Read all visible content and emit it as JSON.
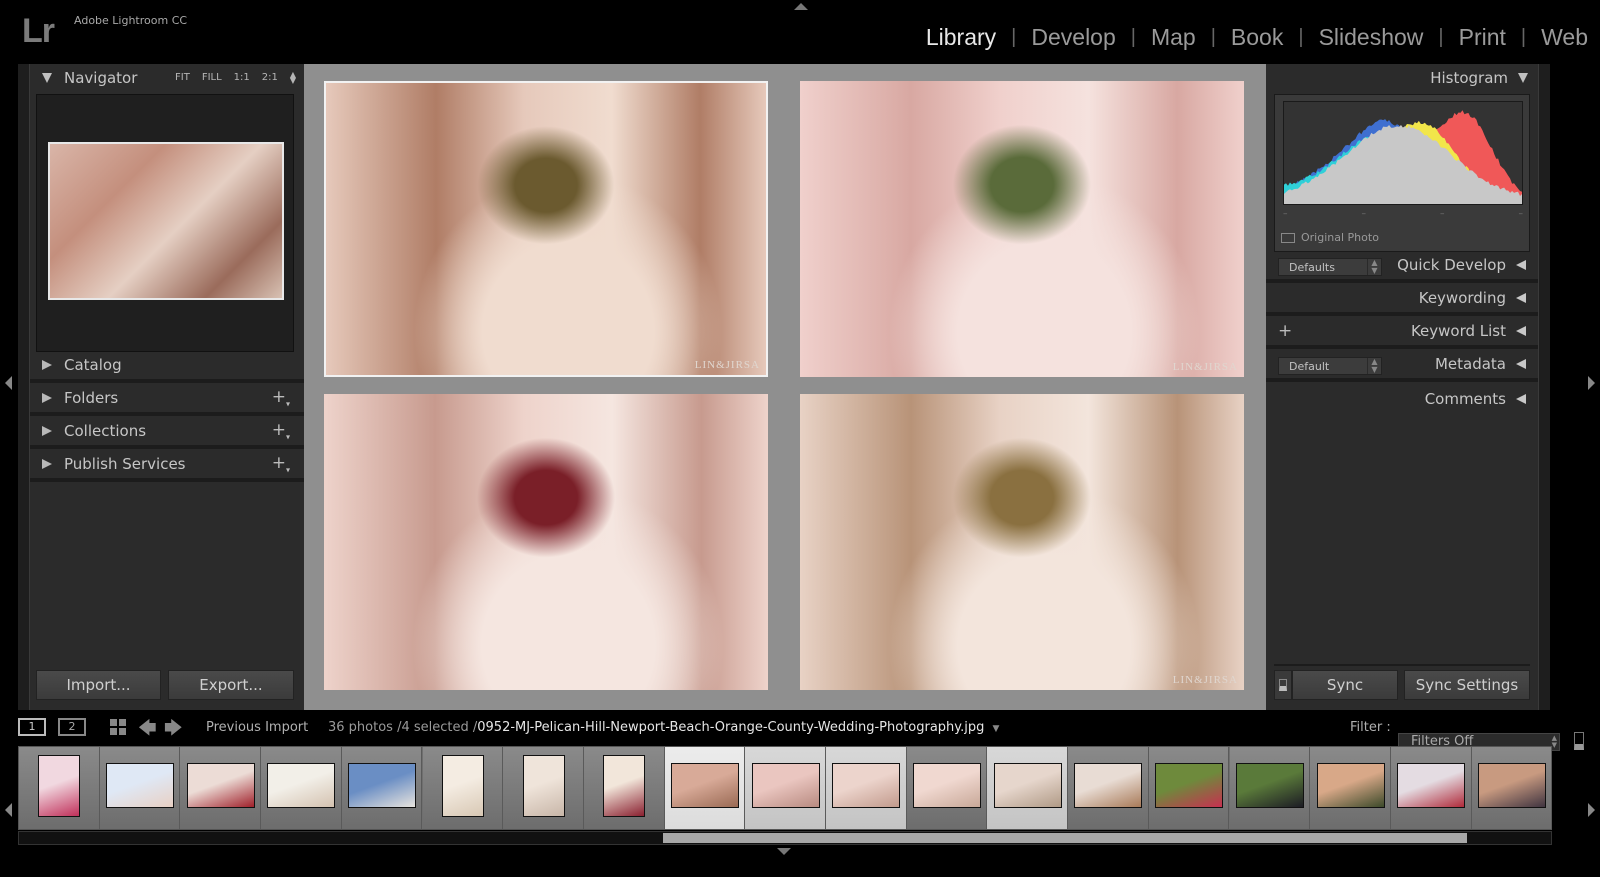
{
  "app": {
    "logo": "Lr",
    "title": "Adobe Lightroom CC"
  },
  "modules": [
    {
      "label": "Library",
      "active": true
    },
    {
      "label": "Develop",
      "active": false
    },
    {
      "label": "Map",
      "active": false
    },
    {
      "label": "Book",
      "active": false
    },
    {
      "label": "Slideshow",
      "active": false
    },
    {
      "label": "Print",
      "active": false
    },
    {
      "label": "Web",
      "active": false
    }
  ],
  "left_panel": {
    "navigator": {
      "title": "Navigator",
      "zoom_options": [
        "FIT",
        "FILL",
        "1:1",
        "2:1"
      ]
    },
    "sections": [
      {
        "label": "Catalog",
        "has_plus": false
      },
      {
        "label": "Folders",
        "has_plus": true
      },
      {
        "label": "Collections",
        "has_plus": true
      },
      {
        "label": "Publish Services",
        "has_plus": true
      }
    ],
    "import_label": "Import...",
    "export_label": "Export..."
  },
  "right_panel": {
    "histogram": {
      "title": "Histogram",
      "original_photo_label": "Original Photo"
    },
    "quick_develop": {
      "label": "Quick Develop",
      "preset": "Defaults"
    },
    "keywording": {
      "label": "Keywording"
    },
    "keyword_list": {
      "label": "Keyword List",
      "plus": "+"
    },
    "metadata": {
      "label": "Metadata",
      "preset": "Default"
    },
    "comments": {
      "label": "Comments"
    },
    "sync_label": "Sync",
    "sync_settings_label": "Sync Settings"
  },
  "center": {
    "view": "survey",
    "photos": [
      {
        "id": "photo-1",
        "selected": true,
        "watermark": "LIN&JIRSA",
        "palette": [
          "#e6c9bb",
          "#b07d66",
          "#f0dccf",
          "#6b5a2f"
        ]
      },
      {
        "id": "photo-2",
        "selected": false,
        "watermark": "LIN&JIRSA",
        "palette": [
          "#f0d0cc",
          "#d8a8a2",
          "#f5e2de",
          "#5a6b3a"
        ]
      },
      {
        "id": "photo-3",
        "selected": false,
        "watermark": "",
        "palette": [
          "#eed3cb",
          "#c79a8e",
          "#f5e6e0",
          "#7a1f28"
        ]
      },
      {
        "id": "photo-4",
        "selected": false,
        "watermark": "LIN&JIRSA",
        "palette": [
          "#e8d2c5",
          "#b89378",
          "#f3e5dc",
          "#8a7040"
        ]
      }
    ]
  },
  "filmstrip_bar": {
    "monitor_1": "1",
    "monitor_2": "2",
    "source": "Previous Import",
    "count": "36 photos /4 selected /",
    "filename": "0952-MJ-Pelican-Hill-Newport-Beach-Orange-County-Wedding-Photography.jpg",
    "filter_label": "Filter :",
    "filter_value": "Filters Off"
  },
  "filmstrip": {
    "thumbnails": [
      {
        "orientation": "portrait",
        "state": "normal",
        "colors": [
          "#f1d8e0",
          "#c0305a"
        ]
      },
      {
        "orientation": "landscape",
        "state": "normal",
        "colors": [
          "#dfe8f5",
          "#e8d0c4"
        ]
      },
      {
        "orientation": "landscape",
        "state": "normal",
        "colors": [
          "#ecdcd6",
          "#a0202a"
        ]
      },
      {
        "orientation": "landscape",
        "state": "normal",
        "colors": [
          "#f2efe8",
          "#d4c2b0"
        ]
      },
      {
        "orientation": "landscape",
        "state": "normal",
        "colors": [
          "#6a8ec4",
          "#e8e4de"
        ]
      },
      {
        "orientation": "portrait",
        "state": "normal",
        "colors": [
          "#f4ece2",
          "#d8c8b4"
        ]
      },
      {
        "orientation": "portrait",
        "state": "normal",
        "colors": [
          "#efe4da",
          "#c8b6a8"
        ]
      },
      {
        "orientation": "portrait",
        "state": "normal",
        "colors": [
          "#f2e6da",
          "#8a2030"
        ]
      },
      {
        "orientation": "landscape",
        "state": "active",
        "colors": [
          "#d8aa98",
          "#9a6a54"
        ]
      },
      {
        "orientation": "landscape",
        "state": "selected",
        "colors": [
          "#eac6c0",
          "#b88a80"
        ]
      },
      {
        "orientation": "landscape",
        "state": "selected",
        "colors": [
          "#ecd4cc",
          "#c29a8c"
        ]
      },
      {
        "orientation": "landscape",
        "state": "normal",
        "colors": [
          "#f0d8d0",
          "#c8a898"
        ]
      },
      {
        "orientation": "landscape",
        "state": "selected",
        "colors": [
          "#e6d6cc",
          "#b09a86"
        ]
      },
      {
        "orientation": "landscape",
        "state": "normal",
        "colors": [
          "#e8dcd4",
          "#a87a58"
        ]
      },
      {
        "orientation": "landscape",
        "state": "normal",
        "colors": [
          "#6e8a3c",
          "#c83050"
        ]
      },
      {
        "orientation": "landscape",
        "state": "normal",
        "colors": [
          "#5a7a3a",
          "#1c1c24"
        ]
      },
      {
        "orientation": "landscape",
        "state": "normal",
        "colors": [
          "#d8a888",
          "#3c4a2a"
        ]
      },
      {
        "orientation": "landscape",
        "state": "normal",
        "colors": [
          "#e4dce2",
          "#b02a3a"
        ]
      },
      {
        "orientation": "landscape",
        "state": "normal",
        "colors": [
          "#c89a80",
          "#403440"
        ]
      }
    ],
    "scroll_position": 0.42
  },
  "histogram_data": {
    "channels": [
      "blue",
      "cyan",
      "green",
      "yellow",
      "red",
      "luminance"
    ],
    "colors": {
      "blue": "#3f6fd0",
      "cyan": "#2fd0d8",
      "green": "#4cc85a",
      "yellow": "#f2e64a",
      "red": "#f05858",
      "luminance": "#c8c8c8"
    }
  }
}
